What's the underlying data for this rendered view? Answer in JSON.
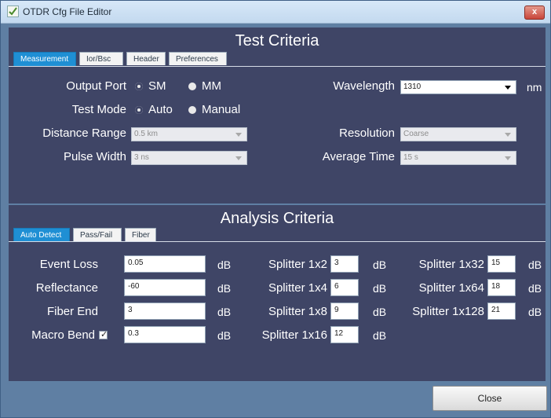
{
  "window": {
    "title": "OTDR Cfg File Editor",
    "close_glyph": "x"
  },
  "test_criteria": {
    "title": "Test Criteria",
    "tabs": [
      {
        "label": "Measurement",
        "active": true
      },
      {
        "label": "Ior/Bsc",
        "active": false
      },
      {
        "label": "Header",
        "active": false
      },
      {
        "label": "Preferences",
        "active": false
      }
    ],
    "output_port": {
      "label": "Output Port",
      "options": [
        "SM",
        "MM"
      ],
      "selected": "SM"
    },
    "test_mode": {
      "label": "Test Mode",
      "options": [
        "Auto",
        "Manual"
      ],
      "selected": "Auto"
    },
    "distance_range": {
      "label": "Distance Range",
      "value": "0.5 km"
    },
    "pulse_width": {
      "label": "Pulse Width",
      "value": "3 ns"
    },
    "wavelength": {
      "label": "Wavelength",
      "value": "1310",
      "unit": "nm"
    },
    "resolution": {
      "label": "Resolution",
      "value": "Coarse"
    },
    "average_time": {
      "label": "Average Time",
      "value": "15 s"
    }
  },
  "analysis_criteria": {
    "title": "Analysis Criteria",
    "tabs": [
      {
        "label": "Auto Detect",
        "active": true
      },
      {
        "label": "Pass/Fail",
        "active": false
      },
      {
        "label": "Fiber",
        "active": false
      }
    ],
    "rows": [
      {
        "label": "Event Loss",
        "value": "0.05",
        "unit": "dB"
      },
      {
        "label": "Reflectance",
        "value": "-60",
        "unit": "dB"
      },
      {
        "label": "Fiber End",
        "value": "3",
        "unit": "dB"
      },
      {
        "label": "Macro Bend",
        "value": "0.3",
        "unit": "dB",
        "checked": true,
        "check_glyph": "✓"
      }
    ],
    "splitters_a": [
      {
        "label": "Splitter 1x2",
        "value": "3",
        "unit": "dB"
      },
      {
        "label": "Splitter 1x4",
        "value": "6",
        "unit": "dB"
      },
      {
        "label": "Splitter 1x8",
        "value": "9",
        "unit": "dB"
      },
      {
        "label": "Splitter 1x16",
        "value": "12",
        "unit": "dB"
      }
    ],
    "splitters_b": [
      {
        "label": "Splitter 1x32",
        "value": "15",
        "unit": "dB"
      },
      {
        "label": "Splitter 1x64",
        "value": "18",
        "unit": "dB"
      },
      {
        "label": "Splitter 1x128",
        "value": "21",
        "unit": "dB"
      }
    ]
  },
  "footer": {
    "close_label": "Close"
  },
  "colors": {
    "panel": "#3f4566",
    "frame": "#5f7fa3",
    "tab_active": "#1f8fd4"
  }
}
